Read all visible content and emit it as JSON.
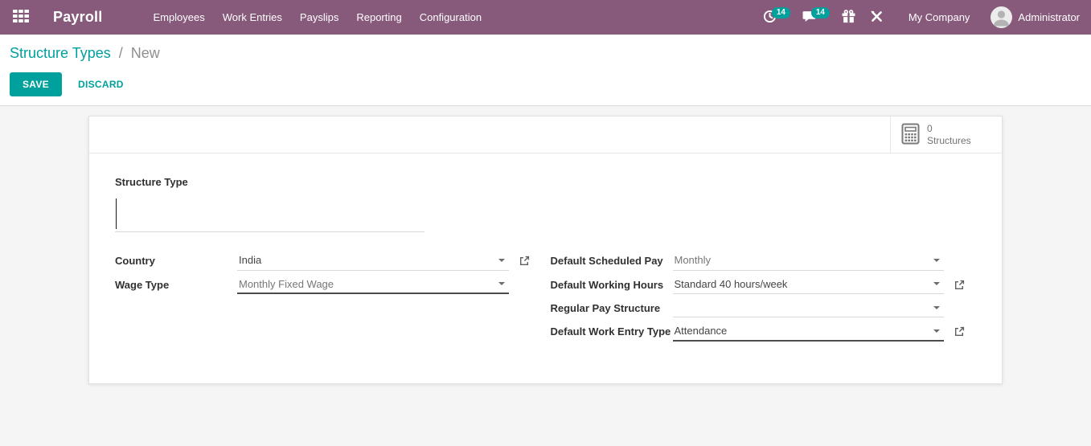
{
  "colors": {
    "navbar_bg": "#875A7B",
    "primary_teal": "#00A09D",
    "badge_bg": "#00A09D",
    "content_bg": "#f5f5f5",
    "label_text": "#303030",
    "field_text": "#444444",
    "muted_text": "#777777"
  },
  "icons": {
    "apps": "grid-icon",
    "activities": "clock-icon",
    "messages": "chat-bubble-icon",
    "rewards": "gift-icon",
    "tools": "wrench-icon",
    "user": "person-avatar",
    "structures": "calculator-icon",
    "dropdown": "caret-down-icon",
    "open_record": "external-link-icon",
    "cursor": "text-cursor"
  },
  "navbar": {
    "app_name": "Payroll",
    "menu": [
      "Employees",
      "Work Entries",
      "Payslips",
      "Reporting",
      "Configuration"
    ],
    "activity_count": "14",
    "message_count": "14",
    "company": "My Company",
    "user": "Administrator"
  },
  "breadcrumb": {
    "parent": "Structure Types",
    "separator": "/",
    "current": "New"
  },
  "actions": {
    "save": "SAVE",
    "discard": "DISCARD"
  },
  "stat_button": {
    "value": "0",
    "label": "Structures"
  },
  "form": {
    "title_field": {
      "label": "Structure Type",
      "value": ""
    },
    "left": [
      {
        "label": "Country",
        "value": "India"
      },
      {
        "label": "Wage Type",
        "value": "Monthly Fixed Wage"
      }
    ],
    "right": [
      {
        "label": "Default Scheduled Pay",
        "value": "Monthly"
      },
      {
        "label": "Default Working Hours",
        "value": "Standard 40 hours/week"
      },
      {
        "label": "Regular Pay Structure",
        "value": ""
      },
      {
        "label": "Default Work Entry Type",
        "value": "Attendance"
      }
    ]
  }
}
